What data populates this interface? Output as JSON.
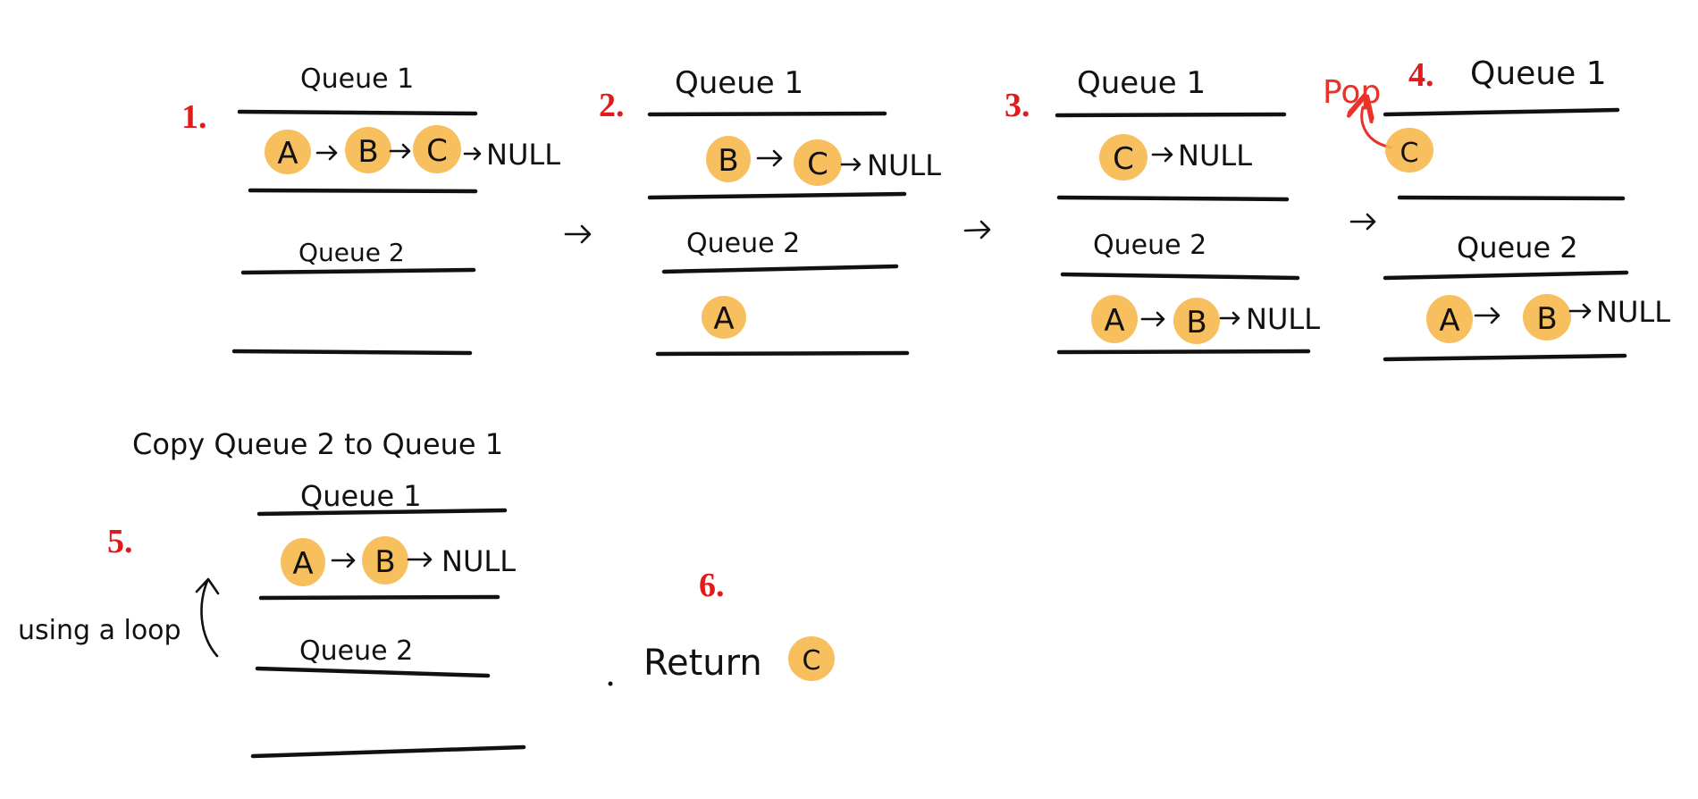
{
  "diagram": {
    "colors": {
      "ink": "#111111",
      "step_number": "#e01b1b",
      "annotation": "#e8322a",
      "node_highlight": "#f7b84e"
    },
    "steps": [
      {
        "number": "1.",
        "queues": [
          {
            "label": "Queue 1",
            "nodes": [
              "A",
              "B",
              "C"
            ],
            "tail": "NULL"
          },
          {
            "label": "Queue 2",
            "nodes": [],
            "tail": ""
          }
        ]
      },
      {
        "number": "2.",
        "queues": [
          {
            "label": "Queue 1",
            "nodes": [
              "B",
              "C"
            ],
            "tail": "NULL"
          },
          {
            "label": "Queue 2",
            "nodes": [
              "A"
            ],
            "tail": ""
          }
        ]
      },
      {
        "number": "3.",
        "queues": [
          {
            "label": "Queue 1",
            "nodes": [
              "C"
            ],
            "tail": "NULL"
          },
          {
            "label": "Queue 2",
            "nodes": [
              "A",
              "B"
            ],
            "tail": "NULL"
          }
        ]
      },
      {
        "number": "4.",
        "annotation": "Pop",
        "queues": [
          {
            "label": "Queue 1",
            "nodes": [
              "C"
            ],
            "tail": ""
          },
          {
            "label": "Queue 2",
            "nodes": [
              "A",
              "B"
            ],
            "tail": "NULL"
          }
        ]
      },
      {
        "number": "5.",
        "heading": "Copy Queue 2 to Queue 1",
        "side_note": "using a loop",
        "queues": [
          {
            "label": "Queue 1",
            "nodes": [
              "A",
              "B"
            ],
            "tail": "NULL"
          },
          {
            "label": "Queue 2",
            "nodes": [],
            "tail": ""
          }
        ]
      },
      {
        "number": "6.",
        "return_text": "Return",
        "return_node": "C"
      }
    ]
  }
}
